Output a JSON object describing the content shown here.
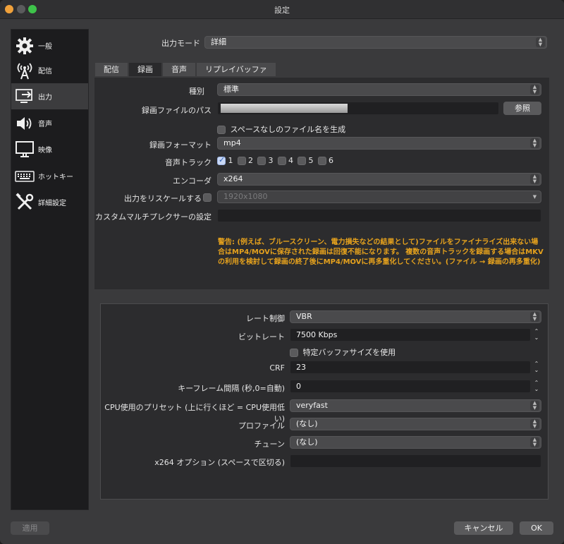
{
  "window": {
    "title": "設定"
  },
  "sidebar": {
    "items": [
      {
        "label": "一般",
        "icon": "gear-icon"
      },
      {
        "label": "配信",
        "icon": "broadcast-antenna-icon"
      },
      {
        "label": "出力",
        "icon": "output-monitor-icon",
        "active": true
      },
      {
        "label": "音声",
        "icon": "speaker-icon"
      },
      {
        "label": "映像",
        "icon": "display-icon"
      },
      {
        "label": "ホットキー",
        "icon": "keyboard-icon"
      },
      {
        "label": "詳細設定",
        "icon": "tools-icon"
      }
    ]
  },
  "output_mode": {
    "label": "出力モード",
    "value": "詳細"
  },
  "tabs": [
    {
      "label": "配信"
    },
    {
      "label": "録画",
      "active": true
    },
    {
      "label": "音声"
    },
    {
      "label": "リプレイバッファ"
    }
  ],
  "recording": {
    "type_label": "種別",
    "type_value": "標準",
    "path_label": "録画ファイルのパス",
    "browse_label": "参照",
    "nospace_label": "スペースなしのファイル名を生成",
    "format_label": "録画フォーマット",
    "format_value": "mp4",
    "audio_track_label": "音声トラック",
    "tracks": [
      {
        "n": "1",
        "checked": true
      },
      {
        "n": "2",
        "checked": false
      },
      {
        "n": "3",
        "checked": false
      },
      {
        "n": "4",
        "checked": false
      },
      {
        "n": "5",
        "checked": false
      },
      {
        "n": "6",
        "checked": false
      }
    ],
    "encoder_label": "エンコーダ",
    "encoder_value": "x264",
    "rescale_label": "出力をリスケールする",
    "rescale_value": "1920x1080",
    "muxer_label": "カスタムマルチプレクサーの設定",
    "warning": "警告: (例えば、ブルースクリーン、電力損失などの結果として)ファイルをファイナライズ出来ない場合はMP4/MOVに保存された録画は回復不能になります。 複数の音声トラックを録画する場合はMKVの利用を検討して録画の終了後にMP4/MOVに再多重化してください。(ファイル → 録画の再多重化)"
  },
  "encoder_settings": {
    "rate_control_label": "レート制御",
    "rate_control_value": "VBR",
    "bitrate_label": "ビットレート",
    "bitrate_value": "7500 Kbps",
    "buffer_label": "特定バッファサイズを使用",
    "crf_label": "CRF",
    "crf_value": "23",
    "keyframe_label": "キーフレーム間隔 (秒,0=自動)",
    "keyframe_value": "0",
    "preset_label": "CPU使用のプリセット (上に行くほど = CPU使用低い)",
    "preset_value": "veryfast",
    "profile_label": "プロファイル",
    "profile_value": "(なし)",
    "tune_label": "チューン",
    "tune_value": "(なし)",
    "options_label": "x264 オプション (スペースで区切る)"
  },
  "footer": {
    "apply_label": "適用",
    "cancel_label": "キャンセル",
    "ok_label": "OK"
  }
}
